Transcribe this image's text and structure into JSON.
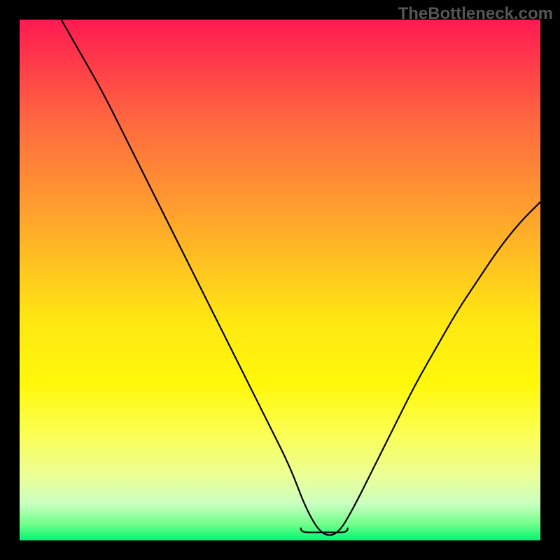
{
  "watermark": "TheBottleneck.com",
  "chart_data": {
    "type": "line",
    "title": "",
    "xlabel": "",
    "ylabel": "",
    "xlim": [
      0,
      100
    ],
    "ylim": [
      0,
      100
    ],
    "grid": false,
    "description": "Single black V-shaped curve over vertical red→yellow→green gradient; left branch starts near top-left, descends to a flat trough around x≈55–62 at the bottom edge, then rises to upper-right.",
    "x": [
      8,
      12,
      16,
      20,
      24,
      28,
      32,
      36,
      40,
      44,
      48,
      52,
      55,
      58,
      61,
      64,
      68,
      72,
      76,
      80,
      84,
      88,
      92,
      96,
      100
    ],
    "values": [
      100,
      93,
      86,
      78,
      70,
      62,
      54,
      46,
      38,
      30,
      22,
      14,
      6,
      1,
      1,
      6,
      14,
      22,
      30,
      37,
      44,
      50,
      56,
      61,
      65
    ],
    "trough_highlight": {
      "x_start": 54,
      "x_end": 63,
      "y": 1,
      "color": "#d07a7a"
    },
    "gradient_stops": [
      {
        "pos": 0,
        "color": "#ff1a52"
      },
      {
        "pos": 50,
        "color": "#ffd018"
      },
      {
        "pos": 80,
        "color": "#fbff58"
      },
      {
        "pos": 100,
        "color": "#00f573"
      }
    ]
  }
}
